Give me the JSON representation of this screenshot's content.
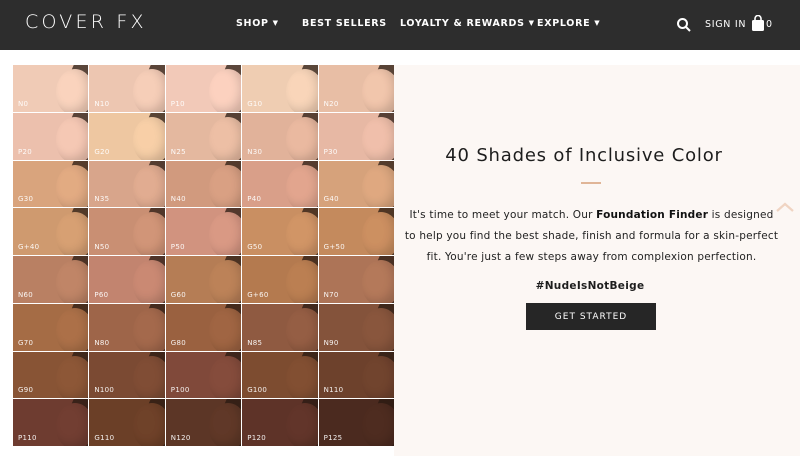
{
  "header": {
    "logo": "COVER FX",
    "nav": [
      {
        "label": "SHOP",
        "caret": true
      },
      {
        "label": "BEST SELLERS",
        "caret": false
      },
      {
        "label": "LOYALTY & REWARDS",
        "caret": true
      },
      {
        "label": "EXPLORE",
        "caret": true
      }
    ],
    "signin_label": "SIGN IN",
    "bag_count": "0",
    "icons": [
      "search-icon",
      "shopping-bag-icon",
      "caret-down-icon"
    ]
  },
  "promo": {
    "headline": "40 Shades of Inclusive Color",
    "body_pre": "It's time to meet your match. Our ",
    "body_bold": "Foundation Finder",
    "body_post": " is designed to help you find the best shade, finish and formula for a skin-perfect fit. You're just a few steps away from complexion perfection.",
    "hashtag": "#NudeIsNotBeige",
    "cta_label": "GET STARTED",
    "accent_color": "#e0b597"
  },
  "shades": [
    {
      "label": "N0",
      "color": "#f0cbb6"
    },
    {
      "label": "N10",
      "color": "#edc6b1"
    },
    {
      "label": "P10",
      "color": "#f2c9b8"
    },
    {
      "label": "G10",
      "color": "#efcdb2"
    },
    {
      "label": "N20",
      "color": "#e8bea5"
    },
    {
      "label": "P20",
      "color": "#ecc0ad"
    },
    {
      "label": "G20",
      "color": "#eec7a1"
    },
    {
      "label": "N25",
      "color": "#e4b89f"
    },
    {
      "label": "N30",
      "color": "#e1b29a"
    },
    {
      "label": "P30",
      "color": "#e7b8a4"
    },
    {
      "label": "G30",
      "color": "#d9a47d"
    },
    {
      "label": "N35",
      "color": "#d8a58b"
    },
    {
      "label": "N40",
      "color": "#d19a7e"
    },
    {
      "label": "P40",
      "color": "#d99f89"
    },
    {
      "label": "G40",
      "color": "#d6a27b"
    },
    {
      "label": "G+40",
      "color": "#cf9a6f"
    },
    {
      "label": "N50",
      "color": "#c98f73"
    },
    {
      "label": "P50",
      "color": "#d1937f"
    },
    {
      "label": "G50",
      "color": "#c98f62"
    },
    {
      "label": "G+50",
      "color": "#c48a5d"
    },
    {
      "label": "N60",
      "color": "#b98063"
    },
    {
      "label": "P60",
      "color": "#c2846f"
    },
    {
      "label": "G60",
      "color": "#b57d55"
    },
    {
      "label": "G+60",
      "color": "#b47a4f"
    },
    {
      "label": "N70",
      "color": "#ad7457"
    },
    {
      "label": "G70",
      "color": "#a56c45"
    },
    {
      "label": "N80",
      "color": "#9e6549"
    },
    {
      "label": "G80",
      "color": "#9a6140"
    },
    {
      "label": "N85",
      "color": "#8f5a41"
    },
    {
      "label": "N90",
      "color": "#84533b"
    },
    {
      "label": "G90",
      "color": "#885435"
    },
    {
      "label": "N100",
      "color": "#7b4a33"
    },
    {
      "label": "P100",
      "color": "#80493a"
    },
    {
      "label": "G100",
      "color": "#7d4c30"
    },
    {
      "label": "N110",
      "color": "#6d412c"
    },
    {
      "label": "P110",
      "color": "#6e3c30"
    },
    {
      "label": "G110",
      "color": "#6b3f27"
    },
    {
      "label": "N120",
      "color": "#5c3626"
    },
    {
      "label": "P120",
      "color": "#5e3328"
    },
    {
      "label": "P125",
      "color": "#4b2a1f"
    }
  ]
}
